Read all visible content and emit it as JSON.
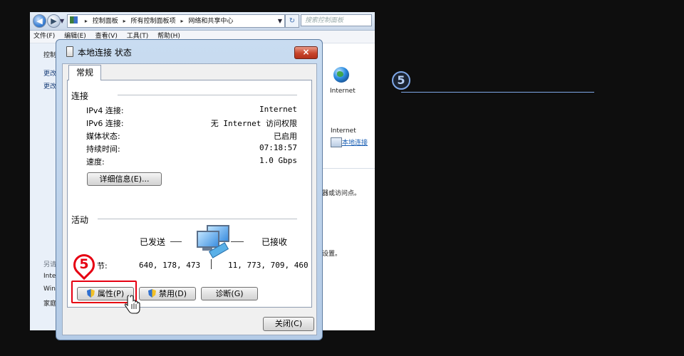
{
  "explorer": {
    "breadcrumb": [
      "控制面板",
      "所有控制面板项",
      "网络和共享中心"
    ],
    "search_placeholder": "搜索控制面板",
    "menu": [
      "文件(F)",
      "编辑(E)",
      "查看(V)",
      "工具(T)",
      "帮助(H)"
    ],
    "fragments": {
      "f1": "控制",
      "f2": "更改",
      "f3": "更改",
      "f4": "另请",
      "f5": "Inte",
      "f6": "Win",
      "f7": "家庭",
      "internet_label": "Internet",
      "access_type_value": "Internet",
      "connection_link": "本地连接",
      "access_text": "器或访问点。",
      "settings_text": "设置。"
    }
  },
  "dialog": {
    "title": "本地连接 状态",
    "close_glyph": "×",
    "tab_general": "常规",
    "connection_group": "连接",
    "rows": [
      {
        "label": "IPv4 连接:",
        "value": "Internet"
      },
      {
        "label": "IPv6 连接:",
        "value": "无 Internet 访问权限"
      },
      {
        "label": "媒体状态:",
        "value": "已启用"
      },
      {
        "label": "持续时间:",
        "value": "07:18:57"
      },
      {
        "label": "速度:",
        "value": "1.0 Gbps"
      }
    ],
    "details_button": "详细信息(E)...",
    "activity_group": "活动",
    "sent_label": "已发送",
    "received_label": "已接收",
    "bytes_label": "节:",
    "bytes_sent": "640, 178, 473",
    "bytes_received": "11, 773, 709, 460",
    "properties_button": "属性(P)",
    "disable_button": "禁用(D)",
    "diagnose_button": "诊断(G)",
    "close_button": "关闭(C)"
  },
  "annotations": {
    "pin_number": "5",
    "step_number": "5",
    "highlight_color": "#e60012",
    "step_color": "#7fa8e8"
  }
}
